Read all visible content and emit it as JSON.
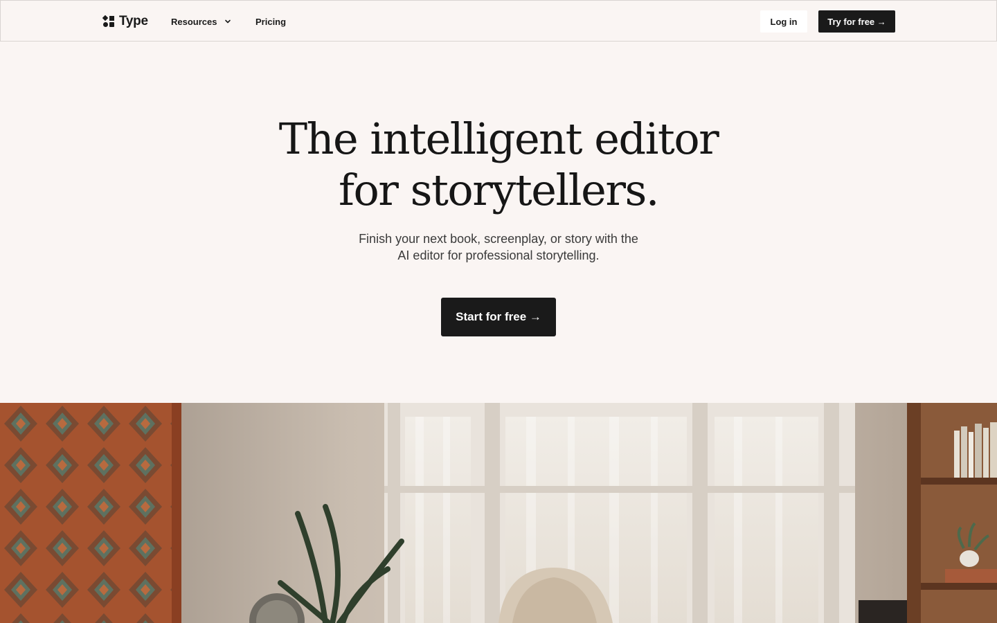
{
  "header": {
    "logo_text": "Type",
    "logo_icon": "type-logo-icon",
    "nav": {
      "resources_label": "Resources",
      "resources_icon": "chevron-down-icon",
      "pricing_label": "Pricing"
    },
    "login_label": "Log in",
    "try_label": "Try for free →"
  },
  "hero": {
    "title_line1": "The intelligent editor",
    "title_line2": "for storytellers.",
    "subtitle_line1": "Finish your next book, screenplay, or story with the",
    "subtitle_line2": "AI editor for professional storytelling.",
    "cta_label": "Start for free →"
  },
  "colors": {
    "background": "#faf5f3",
    "text": "#1a1a1a",
    "button_dark": "#1a1a1a",
    "button_light": "#ffffff"
  }
}
